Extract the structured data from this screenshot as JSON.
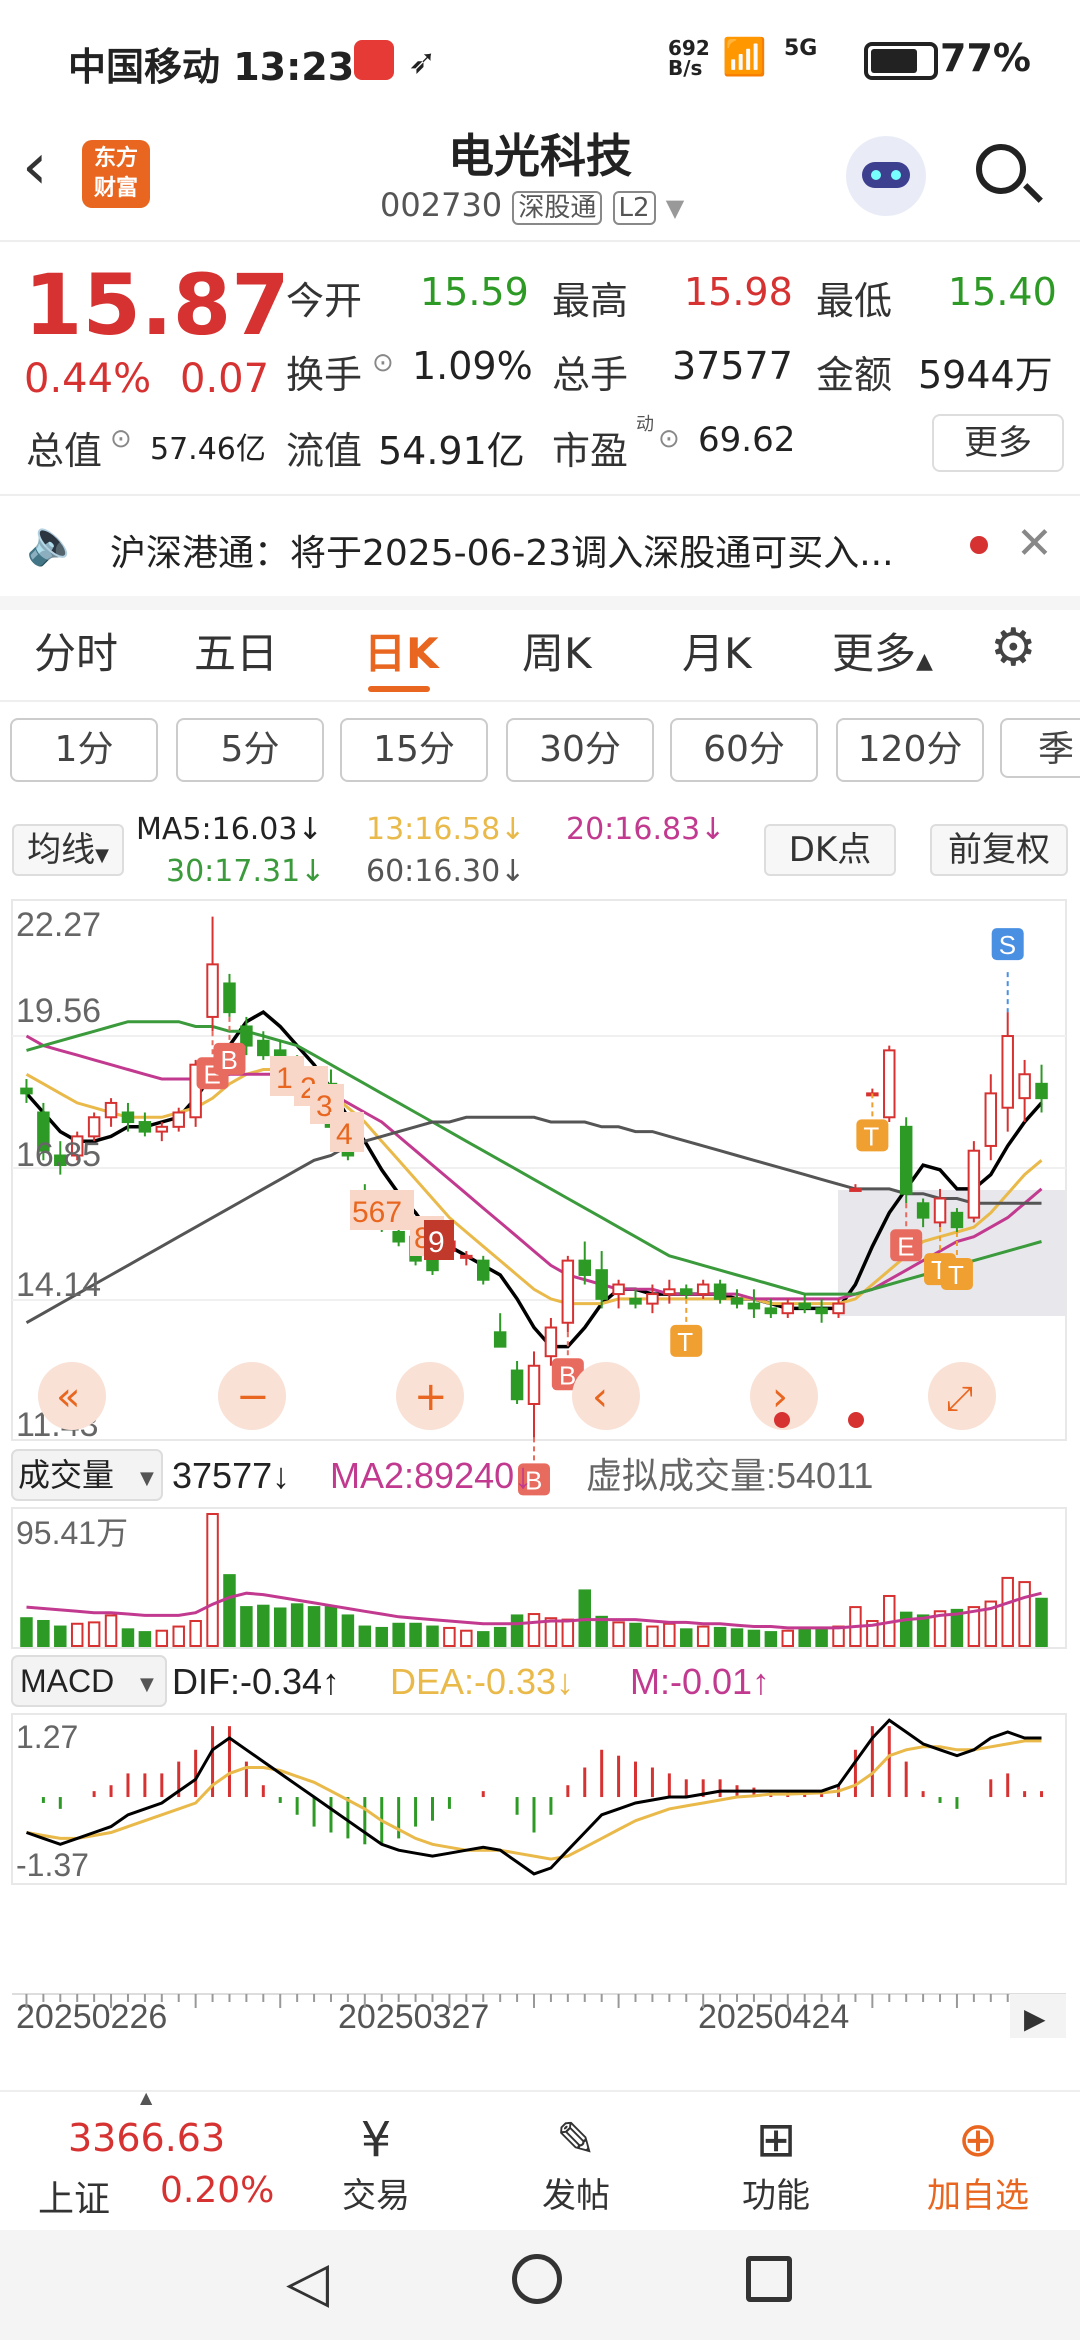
{
  "status_bar": {
    "carrier_time": "中国移动 13:23",
    "net_speed_top": "692",
    "net_speed_bottom": "B/s",
    "signal": "5G",
    "battery": "77%"
  },
  "header": {
    "app_logo_line1": "东方",
    "app_logo_line2": "财富",
    "stock_name": "电光科技",
    "stock_code": "002730",
    "badge_connect": "深股通",
    "badge_level": "L2"
  },
  "quote": {
    "price": "15.87",
    "change_pct": "0.44%",
    "change_amt": "0.07",
    "open_label": "今开",
    "open_value": "15.59",
    "high_label": "最高",
    "high_value": "15.98",
    "low_label": "最低",
    "low_value": "15.40",
    "turnover_label": "换手",
    "turnover_value": "1.09%",
    "volume_label": "总手",
    "volume_value": "37577",
    "amount_label": "金额",
    "amount_value": "5944万",
    "mktcap_label": "总值",
    "mktcap_value": "57.46亿",
    "float_label": "流值",
    "float_value": "54.91亿",
    "pe_label": "市盈",
    "pe_super": "动",
    "pe_value": "69.62",
    "more_button": "更多"
  },
  "notice": {
    "text": "沪深港通：将于2025-06-23调入深股通可买入..."
  },
  "tabs": [
    "分时",
    "五日",
    "日K",
    "周K",
    "月K",
    "更多"
  ],
  "active_tab": "日K",
  "intervals": [
    "1分",
    "5分",
    "15分",
    "30分",
    "60分",
    "120分",
    "季"
  ],
  "ma_bar": {
    "selector": "均线",
    "ma5": "MA5:16.03↓",
    "ma13": "13:16.58↓",
    "ma20": "20:16.83↓",
    "ma30": "30:17.31↓",
    "ma60": "60:16.30↓",
    "dk_button": "DK点",
    "adjust_button": "前复权"
  },
  "price_axis": [
    "22.27",
    "19.56",
    "16.85",
    "14.14",
    "11.43"
  ],
  "volume_bar": {
    "selector": "成交量",
    "value": "37577↓",
    "ma2": "MA2:89240↓",
    "virtual": "虚拟成交量:54011",
    "axis_top": "95.41万"
  },
  "macd_bar": {
    "selector": "MACD",
    "dif": "DIF:-0.34↑",
    "dea": "DEA:-0.33↓",
    "m": "M:-0.01↑",
    "axis_top": "1.27",
    "axis_bottom": "-1.37"
  },
  "dates": [
    "20250226",
    "20250327",
    "20250424"
  ],
  "markers": {
    "b": "B",
    "e": "E",
    "s": "S",
    "t": "T",
    "n1": "1",
    "n2": "2",
    "n3": "3",
    "n4": "4",
    "n567": "567",
    "n8": "8",
    "n9": "9"
  },
  "bottom_nav": {
    "index_value": "3366.63",
    "index_name": "上证",
    "index_change": "0.20%",
    "trade": "交易",
    "post": "发帖",
    "function": "功能",
    "add": "加自选"
  },
  "colors": {
    "up": "#d63232",
    "down": "#2e9a26",
    "ma5": "#000000",
    "ma13": "#e9b94a",
    "ma20": "#c23a8f",
    "ma30": "#3b9a3b",
    "ma60": "#555555",
    "accent": "#e8661f"
  },
  "chart_data": {
    "type": "candlestick",
    "interval": "日K",
    "price_axis_ticks": [
      22.27,
      19.56,
      16.85,
      14.14,
      11.43
    ],
    "x_ticks": [
      "20250226",
      "20250327",
      "20250424"
    ],
    "candles": [
      {
        "o": 18.7,
        "h": 18.9,
        "l": 18.4,
        "c": 18.6
      },
      {
        "o": 18.2,
        "h": 18.4,
        "l": 17.2,
        "c": 17.4
      },
      {
        "o": 17.3,
        "h": 17.6,
        "l": 16.9,
        "c": 17.1
      },
      {
        "o": 17.3,
        "h": 17.8,
        "l": 17.2,
        "c": 17.7
      },
      {
        "o": 17.7,
        "h": 18.2,
        "l": 17.6,
        "c": 18.1
      },
      {
        "o": 18.1,
        "h": 18.5,
        "l": 17.9,
        "c": 18.4
      },
      {
        "o": 18.2,
        "h": 18.4,
        "l": 17.8,
        "c": 18.0
      },
      {
        "o": 18.0,
        "h": 18.2,
        "l": 17.7,
        "c": 17.8
      },
      {
        "o": 17.8,
        "h": 18.0,
        "l": 17.6,
        "c": 17.9
      },
      {
        "o": 17.9,
        "h": 18.3,
        "l": 17.8,
        "c": 18.2
      },
      {
        "o": 18.1,
        "h": 19.3,
        "l": 17.9,
        "c": 19.2
      },
      {
        "o": 20.2,
        "h": 22.3,
        "l": 19.9,
        "c": 21.3
      },
      {
        "o": 20.9,
        "h": 21.1,
        "l": 20.2,
        "c": 20.3
      },
      {
        "o": 20.0,
        "h": 20.2,
        "l": 19.4,
        "c": 19.6
      },
      {
        "o": 19.7,
        "h": 19.9,
        "l": 19.3,
        "c": 19.4
      },
      {
        "o": 19.5,
        "h": 19.7,
        "l": 19.1,
        "c": 19.2
      },
      {
        "o": 19.3,
        "h": 19.4,
        "l": 18.7,
        "c": 18.9
      },
      {
        "o": 18.8,
        "h": 19.0,
        "l": 18.3,
        "c": 18.4
      },
      {
        "o": 18.8,
        "h": 19.1,
        "l": 17.8,
        "c": 17.9
      },
      {
        "o": 17.8,
        "h": 18.1,
        "l": 17.2,
        "c": 17.3
      },
      {
        "o": 16.5,
        "h": 16.7,
        "l": 15.9,
        "c": 16.0
      },
      {
        "o": 16.2,
        "h": 16.3,
        "l": 15.7,
        "c": 15.8
      },
      {
        "o": 15.7,
        "h": 15.9,
        "l": 15.4,
        "c": 15.5
      },
      {
        "o": 15.6,
        "h": 15.8,
        "l": 15.0,
        "c": 15.1
      },
      {
        "o": 15.3,
        "h": 15.5,
        "l": 14.8,
        "c": 14.9
      },
      {
        "o": 15.3,
        "h": 15.6,
        "l": 15.2,
        "c": 15.5
      },
      {
        "o": 15.2,
        "h": 15.3,
        "l": 15.0,
        "c": 15.2
      },
      {
        "o": 15.1,
        "h": 15.2,
        "l": 14.6,
        "c": 14.7
      },
      {
        "o": 13.6,
        "h": 14.0,
        "l": 13.3,
        "c": 13.3
      },
      {
        "o": 12.8,
        "h": 13.0,
        "l": 12.1,
        "c": 12.2
      },
      {
        "o": 12.1,
        "h": 13.2,
        "l": 11.4,
        "c": 12.9
      },
      {
        "o": 13.1,
        "h": 13.9,
        "l": 12.9,
        "c": 13.7
      },
      {
        "o": 13.8,
        "h": 15.2,
        "l": 13.6,
        "c": 15.1
      },
      {
        "o": 15.1,
        "h": 15.5,
        "l": 14.6,
        "c": 14.8
      },
      {
        "o": 14.9,
        "h": 15.3,
        "l": 14.1,
        "c": 14.3
      },
      {
        "o": 14.4,
        "h": 14.7,
        "l": 14.1,
        "c": 14.6
      },
      {
        "o": 14.3,
        "h": 14.5,
        "l": 14.1,
        "c": 14.2
      },
      {
        "o": 14.2,
        "h": 14.6,
        "l": 14.0,
        "c": 14.4
      },
      {
        "o": 14.4,
        "h": 14.7,
        "l": 14.2,
        "c": 14.5
      },
      {
        "o": 14.5,
        "h": 14.6,
        "l": 14.3,
        "c": 14.4
      },
      {
        "o": 14.4,
        "h": 14.7,
        "l": 14.3,
        "c": 14.6
      },
      {
        "o": 14.6,
        "h": 14.7,
        "l": 14.2,
        "c": 14.3
      },
      {
        "o": 14.3,
        "h": 14.5,
        "l": 14.1,
        "c": 14.2
      },
      {
        "o": 14.2,
        "h": 14.5,
        "l": 13.9,
        "c": 14.1
      },
      {
        "o": 14.1,
        "h": 14.3,
        "l": 13.9,
        "c": 14.0
      },
      {
        "o": 14.0,
        "h": 14.3,
        "l": 13.9,
        "c": 14.2
      },
      {
        "o": 14.2,
        "h": 14.4,
        "l": 14.0,
        "c": 14.1
      },
      {
        "o": 14.1,
        "h": 14.3,
        "l": 13.8,
        "c": 14.0
      },
      {
        "o": 14.0,
        "h": 14.3,
        "l": 13.9,
        "c": 14.2
      },
      {
        "o": 16.6,
        "h": 16.7,
        "l": 16.6,
        "c": 16.6
      },
      {
        "o": 18.6,
        "h": 18.7,
        "l": 18.6,
        "c": 18.6
      },
      {
        "o": 18.1,
        "h": 19.6,
        "l": 18.0,
        "c": 19.5
      },
      {
        "o": 17.9,
        "h": 18.1,
        "l": 16.3,
        "c": 16.5
      },
      {
        "o": 16.3,
        "h": 16.4,
        "l": 15.8,
        "c": 16.0
      },
      {
        "o": 15.9,
        "h": 16.6,
        "l": 15.8,
        "c": 16.4
      },
      {
        "o": 16.1,
        "h": 16.2,
        "l": 15.7,
        "c": 15.8
      },
      {
        "o": 16.0,
        "h": 17.6,
        "l": 15.9,
        "c": 17.4
      },
      {
        "o": 17.5,
        "h": 19.0,
        "l": 17.2,
        "c": 18.6
      },
      {
        "o": 18.3,
        "h": 20.3,
        "l": 17.8,
        "c": 19.8
      },
      {
        "o": 18.5,
        "h": 19.3,
        "l": 18.0,
        "c": 19.0
      },
      {
        "o": 18.8,
        "h": 19.2,
        "l": 18.2,
        "c": 18.5
      }
    ],
    "ma_series": [
      {
        "name": "MA5",
        "values": [
          18.6,
          18.2,
          17.8,
          17.6,
          17.6,
          17.7,
          17.9,
          17.9,
          18.0,
          18.1,
          18.5,
          19.0,
          19.6,
          20.1,
          20.3,
          20.0,
          19.6,
          19.2,
          18.7,
          18.1,
          17.6,
          17.0,
          16.5,
          16.1,
          15.6,
          15.4,
          15.2,
          15.0,
          14.8,
          14.3,
          13.7,
          13.3,
          13.3,
          13.7,
          14.2,
          14.5,
          14.5,
          14.4,
          14.4,
          14.4,
          14.4,
          14.4,
          14.3,
          14.3,
          14.2,
          14.1,
          14.1,
          14.1,
          14.1,
          14.6,
          15.4,
          16.1,
          16.6,
          17.1,
          17.0,
          16.6,
          16.6,
          16.9,
          17.5,
          18.0,
          18.4
        ]
      },
      {
        "name": "13",
        "values": [
          19.0,
          18.8,
          18.6,
          18.4,
          18.3,
          18.2,
          18.1,
          18.1,
          18.1,
          18.2,
          18.3,
          18.5,
          18.8,
          19.0,
          19.1,
          19.1,
          19.0,
          18.8,
          18.6,
          18.3,
          18.0,
          17.6,
          17.2,
          16.8,
          16.4,
          16.0,
          15.7,
          15.4,
          15.1,
          14.8,
          14.5,
          14.3,
          14.2,
          14.2,
          14.2,
          14.3,
          14.3,
          14.3,
          14.3,
          14.3,
          14.3,
          14.3,
          14.3,
          14.3,
          14.2,
          14.2,
          14.2,
          14.2,
          14.2,
          14.3,
          14.6,
          14.9,
          15.2,
          15.5,
          15.6,
          15.7,
          15.8,
          16.1,
          16.5,
          16.9,
          17.2
        ]
      },
      {
        "name": "20",
        "values": [
          19.8,
          19.6,
          19.5,
          19.4,
          19.3,
          19.2,
          19.1,
          19.0,
          18.9,
          18.9,
          18.9,
          18.9,
          19.0,
          19.0,
          19.0,
          19.0,
          18.9,
          18.8,
          18.6,
          18.4,
          18.2,
          18.0,
          17.7,
          17.4,
          17.1,
          16.8,
          16.5,
          16.2,
          15.9,
          15.6,
          15.3,
          15.0,
          14.8,
          14.7,
          14.6,
          14.5,
          14.5,
          14.5,
          14.4,
          14.4,
          14.4,
          14.4,
          14.4,
          14.3,
          14.3,
          14.3,
          14.3,
          14.3,
          14.3,
          14.4,
          14.5,
          14.7,
          14.9,
          15.1,
          15.3,
          15.5,
          15.6,
          15.8,
          16.0,
          16.3,
          16.6
        ]
      },
      {
        "name": "30",
        "values": [
          19.5,
          19.6,
          19.7,
          19.8,
          19.9,
          20.0,
          20.1,
          20.1,
          20.1,
          20.1,
          20.0,
          20.0,
          19.9,
          19.9,
          19.8,
          19.7,
          19.6,
          19.4,
          19.2,
          19.0,
          18.8,
          18.6,
          18.4,
          18.2,
          18.0,
          17.8,
          17.6,
          17.4,
          17.2,
          17.0,
          16.8,
          16.6,
          16.4,
          16.2,
          16.0,
          15.8,
          15.6,
          15.4,
          15.2,
          15.1,
          15.0,
          14.9,
          14.8,
          14.7,
          14.6,
          14.5,
          14.4,
          14.4,
          14.4,
          14.4,
          14.5,
          14.6,
          14.7,
          14.8,
          14.9,
          15.0,
          15.1,
          15.2,
          15.3,
          15.4,
          15.5
        ]
      },
      {
        "name": "60",
        "values": [
          13.8,
          14.0,
          14.2,
          14.4,
          14.6,
          14.8,
          15.0,
          15.2,
          15.4,
          15.6,
          15.8,
          16.0,
          16.2,
          16.4,
          16.6,
          16.8,
          17.0,
          17.2,
          17.3,
          17.5,
          17.6,
          17.7,
          17.8,
          17.9,
          18.0,
          18.0,
          18.1,
          18.1,
          18.1,
          18.1,
          18.1,
          18.0,
          18.0,
          18.0,
          17.9,
          17.9,
          17.8,
          17.8,
          17.7,
          17.6,
          17.5,
          17.4,
          17.3,
          17.2,
          17.1,
          17.0,
          16.9,
          16.8,
          16.7,
          16.6,
          16.6,
          16.6,
          16.5,
          16.5,
          16.4,
          16.4,
          16.3,
          16.3,
          16.3,
          16.3,
          16.3
        ]
      }
    ],
    "volume": {
      "axis_top": "95.41万",
      "values": [
        20,
        18,
        14,
        16,
        17,
        22,
        12,
        10,
        11,
        14,
        18,
        95,
        51,
        28,
        29,
        27,
        30,
        28,
        28,
        22,
        14,
        13,
        16,
        16,
        14,
        13,
        11,
        10,
        13,
        22,
        23,
        20,
        19,
        40,
        21,
        17,
        16,
        14,
        16,
        12,
        14,
        13,
        12,
        11,
        10,
        11,
        13,
        12,
        14,
        28,
        18,
        36,
        24,
        22,
        25,
        26,
        28,
        32,
        49,
        46,
        34
      ],
      "ma2": [
        28,
        27,
        26,
        25,
        24,
        24,
        23,
        22,
        22,
        22,
        24,
        30,
        35,
        38,
        37,
        35,
        33,
        31,
        29,
        27,
        25,
        23,
        21,
        20,
        19,
        18,
        17,
        16,
        16,
        16,
        17,
        18,
        18,
        19,
        19,
        19,
        19,
        18,
        17,
        17,
        16,
        16,
        15,
        14,
        14,
        13,
        13,
        13,
        13,
        14,
        15,
        17,
        19,
        20,
        22,
        23,
        25,
        27,
        31,
        35,
        38
      ]
    },
    "macd": {
      "axis": [
        1.27,
        -1.37
      ],
      "dif": [
        -0.6,
        -0.7,
        -0.8,
        -0.7,
        -0.6,
        -0.5,
        -0.3,
        -0.2,
        -0.1,
        0.1,
        0.3,
        0.8,
        1.0,
        0.8,
        0.6,
        0.4,
        0.2,
        0.0,
        -0.2,
        -0.4,
        -0.6,
        -0.8,
        -0.9,
        -0.95,
        -1.0,
        -0.95,
        -0.9,
        -0.85,
        -0.9,
        -1.1,
        -1.3,
        -1.2,
        -0.9,
        -0.6,
        -0.3,
        -0.2,
        -0.1,
        -0.05,
        0.0,
        0.0,
        0.05,
        0.1,
        0.1,
        0.1,
        0.1,
        0.1,
        0.1,
        0.1,
        0.2,
        0.6,
        1.0,
        1.3,
        1.1,
        0.9,
        0.8,
        0.7,
        0.8,
        1.0,
        1.1,
        1.0,
        1.0
      ],
      "dea": [
        -0.6,
        -0.65,
        -0.7,
        -0.7,
        -0.65,
        -0.6,
        -0.5,
        -0.4,
        -0.3,
        -0.2,
        -0.1,
        0.2,
        0.4,
        0.5,
        0.5,
        0.45,
        0.35,
        0.25,
        0.1,
        -0.05,
        -0.2,
        -0.4,
        -0.55,
        -0.7,
        -0.8,
        -0.85,
        -0.9,
        -0.9,
        -0.9,
        -0.95,
        -1.0,
        -1.05,
        -1.0,
        -0.85,
        -0.7,
        -0.55,
        -0.4,
        -0.3,
        -0.2,
        -0.15,
        -0.1,
        -0.05,
        0.0,
        0.02,
        0.05,
        0.05,
        0.06,
        0.07,
        0.1,
        0.2,
        0.4,
        0.7,
        0.8,
        0.85,
        0.85,
        0.8,
        0.8,
        0.85,
        0.9,
        0.95,
        0.95
      ]
    },
    "signals": [
      {
        "type": "E",
        "x_index": 11
      },
      {
        "type": "B",
        "x_index": 12
      },
      {
        "type": "B",
        "x_index": 30
      },
      {
        "type": "B",
        "x_index": 32
      },
      {
        "type": "T",
        "x_index": 39
      },
      {
        "type": "T",
        "x_index": 50
      },
      {
        "type": "E",
        "x_index": 52
      },
      {
        "type": "T",
        "x_index": 54
      },
      {
        "type": "T",
        "x_index": 55
      },
      {
        "type": "S",
        "x_index": 58
      }
    ]
  }
}
